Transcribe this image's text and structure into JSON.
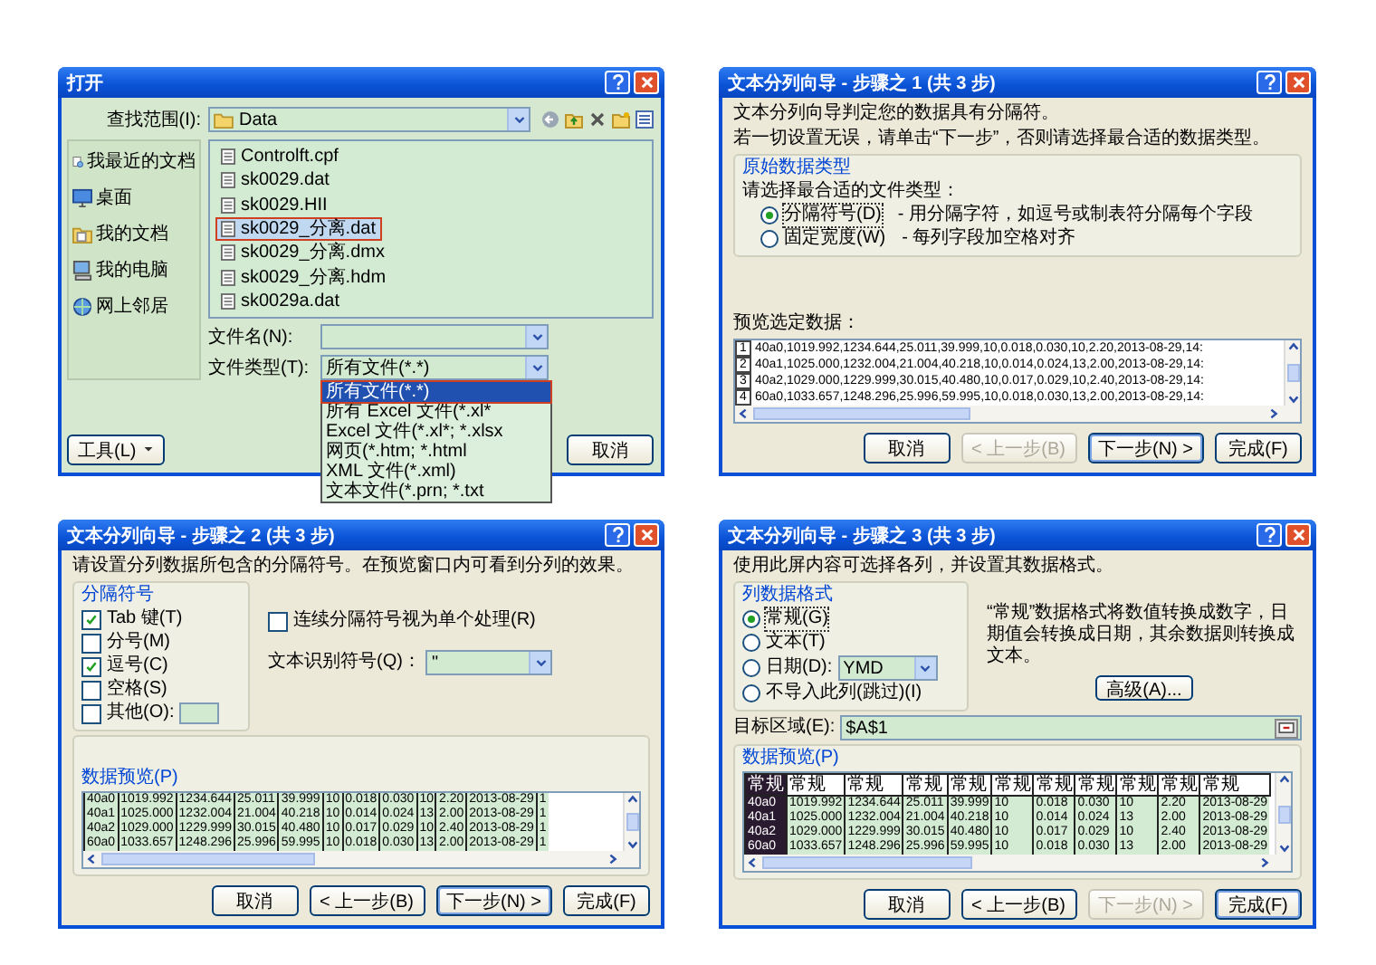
{
  "open_dialog": {
    "title": "打开",
    "look_in_label": "查找范围(I):",
    "look_in_value": "Data",
    "places": [
      {
        "label": "我最近的文档",
        "kind": "recent"
      },
      {
        "label": "桌面",
        "kind": "desktop"
      },
      {
        "label": "我的文档",
        "kind": "documents"
      },
      {
        "label": "我的电脑",
        "kind": "computer"
      },
      {
        "label": "网上邻居",
        "kind": "network"
      }
    ],
    "files": [
      {
        "name": "Controlft.cpf",
        "selected": false
      },
      {
        "name": "sk0029.dat",
        "selected": false
      },
      {
        "name": "sk0029.HII",
        "selected": false
      },
      {
        "name": "sk0029_分离.dat",
        "selected": true
      },
      {
        "name": "sk0029_分离.dmx",
        "selected": false
      },
      {
        "name": "sk0029_分离.hdm",
        "selected": false
      },
      {
        "name": "sk0029a.dat",
        "selected": false
      }
    ],
    "file_name_label": "文件名(N):",
    "file_type_label": "文件类型(T):",
    "file_type_value": "所有文件(*.*)",
    "file_type_options": [
      {
        "text": "所有文件(*.*)",
        "selected": true
      },
      {
        "text": "所有 Excel 文件(*.xl*",
        "selected": false
      },
      {
        "text": "Excel 文件(*.xl*; *.xlsx",
        "selected": false
      },
      {
        "text": "网页(*.htm; *.html",
        "selected": false
      },
      {
        "text": "XML 文件(*.xml)",
        "selected": false
      },
      {
        "text": "文本文件(*.prn; *.txt",
        "selected": false
      }
    ],
    "tools_button": "工具(L)",
    "cancel_button": "取消"
  },
  "wizard_step1": {
    "title": "文本分列向导 - 步骤之 1 (共 3 步)",
    "intro": [
      "文本分列向导判定您的数据具有分隔符。",
      "若一切设置无误，请单击“下一步”，否则请选择最合适的数据类型。"
    ],
    "group_title": "原始数据类型",
    "group_prompt": "请选择最合适的文件类型：",
    "types": [
      {
        "label": "分隔符号(D)",
        "description": "- 用分隔字符，如逗号或制表符分隔每个字段",
        "selected": true
      },
      {
        "label": "固定宽度(W)",
        "description": "- 每列字段加空格对齐",
        "selected": false
      }
    ],
    "preview_label": "预览选定数据：",
    "preview_rows": [
      {
        "number": "1",
        "text": "40a0,1019.992,1234.644,25.011,39.999,10,0.018,0.030,10,2.20,2013-08-29,14:"
      },
      {
        "number": "2",
        "text": "40a1,1025.000,1232.004,21.004,40.218,10,0.014,0.024,13,2.00,2013-08-29,14:"
      },
      {
        "number": "3",
        "text": "40a2,1029.000,1229.999,30.015,40.480,10,0.017,0.029,10,2.40,2013-08-29,14:"
      },
      {
        "number": "4",
        "text": "60a0,1033.657,1248.296,25.996,59.995,10,0.018,0.030,13,2.00,2013-08-29,14:"
      }
    ],
    "buttons": [
      {
        "label": "取消",
        "disabled": false,
        "default": false
      },
      {
        "label": "< 上一步(B)",
        "disabled": true,
        "default": false
      },
      {
        "label": "下一步(N) >",
        "disabled": false,
        "default": true
      },
      {
        "label": "完成(F)",
        "disabled": false,
        "default": false
      }
    ]
  },
  "wizard_step2": {
    "title": "文本分列向导 - 步骤之 2 (共 3 步)",
    "intro": "请设置分列数据所包含的分隔符号。在预览窗口内可看到分列的效果。",
    "group_title": "分隔符号",
    "delimiters": [
      {
        "label": "Tab 键(T)",
        "checked": true,
        "kind": "plain"
      },
      {
        "label": "分号(M)",
        "checked": false,
        "kind": "plain"
      },
      {
        "label": "逗号(C)",
        "checked": true,
        "kind": "plain"
      },
      {
        "label": "空格(S)",
        "checked": false,
        "kind": "plain"
      },
      {
        "label": "其他(O):",
        "checked": false,
        "kind": "other"
      }
    ],
    "consecutive": {
      "label": "连续分隔符号视为单个处理(R)",
      "checked": false
    },
    "qualifier_label": "文本识别符号(Q)：",
    "qualifier_value": "\"",
    "preview_title": "数据预览(P)",
    "rows": [
      [
        "40a0",
        "1019.992",
        "1234.644",
        "25.011",
        "39.999",
        "10",
        "0.018",
        "0.030",
        "10",
        "2.20",
        "2013-08-29",
        "1"
      ],
      [
        "40a1",
        "1025.000",
        "1232.004",
        "21.004",
        "40.218",
        "10",
        "0.014",
        "0.024",
        "13",
        "2.00",
        "2013-08-29",
        "1"
      ],
      [
        "40a2",
        "1029.000",
        "1229.999",
        "30.015",
        "40.480",
        "10",
        "0.017",
        "0.029",
        "10",
        "2.40",
        "2013-08-29",
        "1"
      ],
      [
        "60a0",
        "1033.657",
        "1248.296",
        "25.996",
        "59.995",
        "10",
        "0.018",
        "0.030",
        "13",
        "2.00",
        "2013-08-29",
        "1"
      ]
    ],
    "buttons": [
      {
        "label": "取消",
        "disabled": false,
        "default": false
      },
      {
        "label": "< 上一步(B)",
        "disabled": false,
        "default": false
      },
      {
        "label": "下一步(N) >",
        "disabled": false,
        "default": true
      },
      {
        "label": "完成(F)",
        "disabled": false,
        "default": false
      }
    ]
  },
  "wizard_step3": {
    "title": "文本分列向导 - 步骤之 3 (共 3 步)",
    "intro": "使用此屏内容可选择各列，并设置其数据格式。",
    "group_title": "列数据格式",
    "formats": [
      {
        "label": "常规(G)",
        "selected": true,
        "kind": "plain"
      },
      {
        "label": "文本(T)",
        "selected": false,
        "kind": "plain"
      },
      {
        "label": "日期(D):",
        "selected": false,
        "kind": "date",
        "date_value": "YMD"
      },
      {
        "label": "不导入此列(跳过)(I)",
        "selected": false,
        "kind": "plain"
      }
    ],
    "description": "“常规”数据格式将数值转换成数字，日期值会转换成日期，其余数据则转换成文本。",
    "advanced_button": "高级(A)...",
    "destination_label": "目标区域(E):",
    "destination_value": "$A$1",
    "preview_title": "数据预览(P)",
    "columns": [
      {
        "header": "常规",
        "selected": true
      },
      {
        "header": "常规",
        "selected": false
      },
      {
        "header": "常规",
        "selected": false
      },
      {
        "header": "常规",
        "selected": false
      },
      {
        "header": "常规",
        "selected": false
      },
      {
        "header": "常规",
        "selected": false
      },
      {
        "header": "常规",
        "selected": false
      },
      {
        "header": "常规",
        "selected": false
      },
      {
        "header": "常规",
        "selected": false
      },
      {
        "header": "常规",
        "selected": false
      },
      {
        "header": "常规",
        "selected": false
      }
    ],
    "rows": [
      [
        "40a0",
        "1019.992",
        "1234.644",
        "25.011",
        "39.999",
        "10",
        "0.018",
        "0.030",
        "10",
        "2.20",
        "2013-08-29"
      ],
      [
        "40a1",
        "1025.000",
        "1232.004",
        "21.004",
        "40.218",
        "10",
        "0.014",
        "0.024",
        "13",
        "2.00",
        "2013-08-29"
      ],
      [
        "40a2",
        "1029.000",
        "1229.999",
        "30.015",
        "40.480",
        "10",
        "0.017",
        "0.029",
        "10",
        "2.40",
        "2013-08-29"
      ],
      [
        "60a0",
        "1033.657",
        "1248.296",
        "25.996",
        "59.995",
        "10",
        "0.018",
        "0.030",
        "13",
        "2.00",
        "2013-08-29"
      ]
    ],
    "buttons": [
      {
        "label": "取消",
        "disabled": false,
        "default": false
      },
      {
        "label": "< 上一步(B)",
        "disabled": false,
        "default": false
      },
      {
        "label": "下一步(N) >",
        "disabled": true,
        "default": false
      },
      {
        "label": "完成(F)",
        "disabled": false,
        "default": true
      }
    ]
  }
}
